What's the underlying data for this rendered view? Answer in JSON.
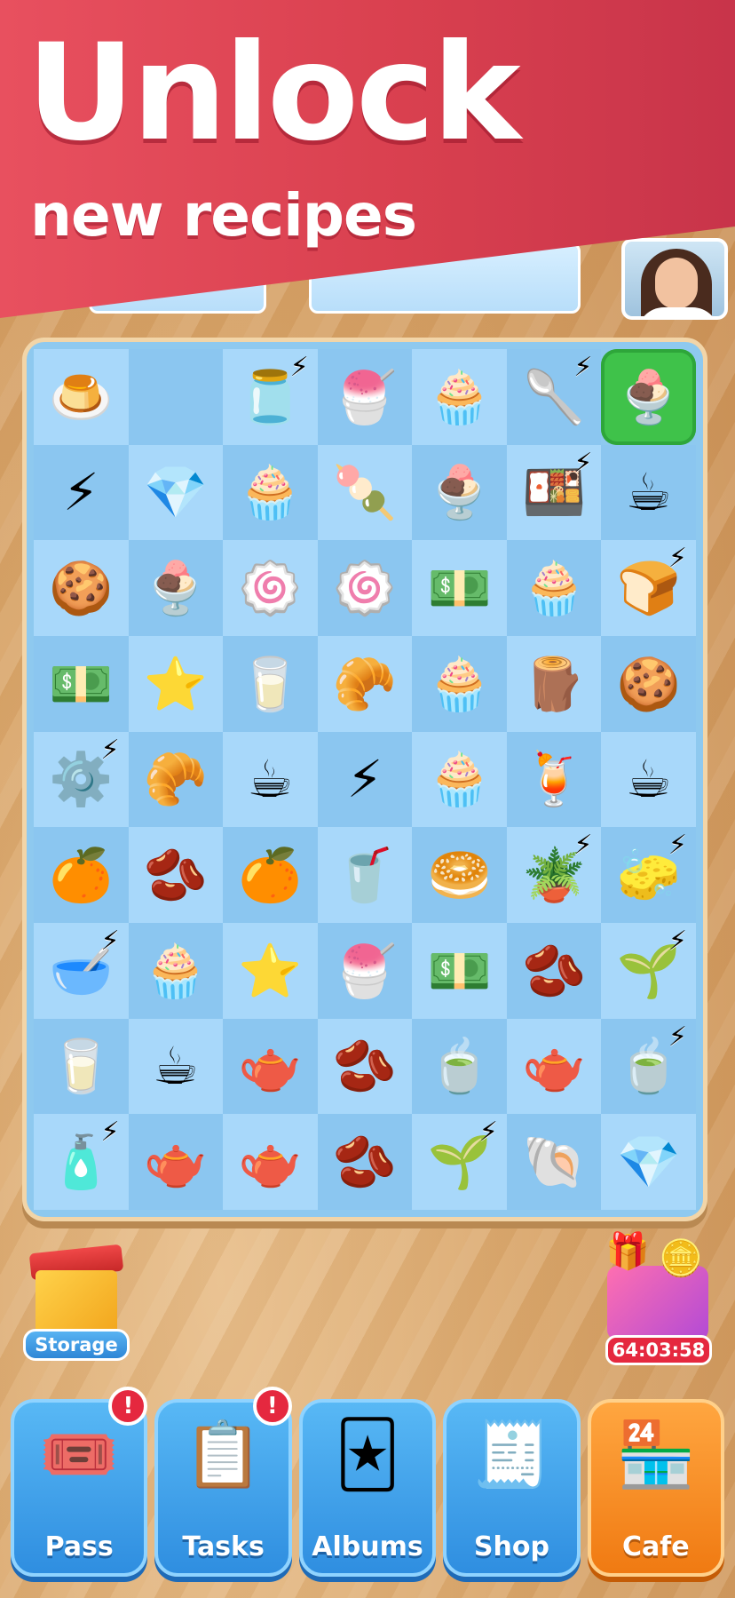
{
  "banner": {
    "title": "Unlock",
    "subtitle": "new recipes"
  },
  "board": {
    "columns": 7,
    "rows": 9,
    "cells": [
      {
        "icon": "🍮",
        "name": "pudding-item"
      },
      {
        "icon": "",
        "name": "empty-cell"
      },
      {
        "icon": "🫙",
        "name": "tea-tin-generator",
        "bolt": true
      },
      {
        "icon": "🍧",
        "name": "strawberry-dessert-item"
      },
      {
        "icon": "🧁",
        "name": "cupcake-item"
      },
      {
        "icon": "🥄",
        "name": "tongs-generator",
        "bolt": true
      },
      {
        "icon": "🍨",
        "name": "berry-dessert-item",
        "selected": true
      },
      {
        "icon": "⚡",
        "name": "energy-item"
      },
      {
        "icon": "💎",
        "name": "gem-item"
      },
      {
        "icon": "🧁",
        "name": "sprinkle-cupcake-item"
      },
      {
        "icon": "🍡",
        "name": "candy-skewer-item"
      },
      {
        "icon": "🍨",
        "name": "parfait-item"
      },
      {
        "icon": "🍱",
        "name": "lunchbox-generator",
        "bolt": true
      },
      {
        "icon": "☕",
        "name": "coffee-cup-item"
      },
      {
        "icon": "🍪",
        "name": "cookies-item"
      },
      {
        "icon": "🍨",
        "name": "berry-dessert-item"
      },
      {
        "icon": "🍥",
        "name": "roll-cakes-item"
      },
      {
        "icon": "🍥",
        "name": "roll-cakes-item"
      },
      {
        "icon": "💵",
        "name": "cash-stack-item"
      },
      {
        "icon": "🧁",
        "name": "muffin-item"
      },
      {
        "icon": "🍞",
        "name": "toaster-generator",
        "bolt": true
      },
      {
        "icon": "💵",
        "name": "cash-item"
      },
      {
        "icon": "⭐",
        "name": "star-item"
      },
      {
        "icon": "🥛",
        "name": "water-glass-item"
      },
      {
        "icon": "🥐",
        "name": "braided-bread-item"
      },
      {
        "icon": "🧁",
        "name": "muffin-item"
      },
      {
        "icon": "🪵",
        "name": "cinnamon-item"
      },
      {
        "icon": "🍪",
        "name": "macaron-item"
      },
      {
        "icon": "⚙️",
        "name": "coffee-grinder-generator",
        "bolt": true
      },
      {
        "icon": "🥐",
        "name": "croissant-item"
      },
      {
        "icon": "☕",
        "name": "latte-item"
      },
      {
        "icon": "⚡",
        "name": "energy-item"
      },
      {
        "icon": "🧁",
        "name": "lemon-cupcake-item"
      },
      {
        "icon": "🍹",
        "name": "cocktail-item"
      },
      {
        "icon": "☕",
        "name": "coffee-cup-item"
      },
      {
        "icon": "🍊",
        "name": "orange-slices-item"
      },
      {
        "icon": "🫘",
        "name": "cocoa-pod-item"
      },
      {
        "icon": "🍊",
        "name": "orange-slices-item"
      },
      {
        "icon": "🥤",
        "name": "iced-latte-item"
      },
      {
        "icon": "🥯",
        "name": "blueberry-bun-item"
      },
      {
        "icon": "🪴",
        "name": "plant-pot-generator",
        "bolt": true
      },
      {
        "icon": "🧽",
        "name": "sponge-generator",
        "bolt": true
      },
      {
        "icon": "🥣",
        "name": "whisk-generator",
        "bolt": true
      },
      {
        "icon": "🧁",
        "name": "muffin-item"
      },
      {
        "icon": "⭐",
        "name": "star-item"
      },
      {
        "icon": "🍧",
        "name": "strawberry-dessert-item"
      },
      {
        "icon": "💵",
        "name": "cash-item"
      },
      {
        "icon": "🫘",
        "name": "coffee-beans-item"
      },
      {
        "icon": "🌱",
        "name": "sprout-generator",
        "bolt": true
      },
      {
        "icon": "🥛",
        "name": "glass-item"
      },
      {
        "icon": "☕",
        "name": "cappuccino-item"
      },
      {
        "icon": "🫖",
        "name": "water-pitcher-item"
      },
      {
        "icon": "🫘",
        "name": "coffee-beans-item"
      },
      {
        "icon": "🍵",
        "name": "lemon-tea-item"
      },
      {
        "icon": "🫖",
        "name": "teapot-item"
      },
      {
        "icon": "🍵",
        "name": "matcha-generator",
        "bolt": true
      },
      {
        "icon": "🧴",
        "name": "water-bottle-generator",
        "bolt": true
      },
      {
        "icon": "🫖",
        "name": "pitcher-item"
      },
      {
        "icon": "🫖",
        "name": "pitcher-item"
      },
      {
        "icon": "🫘",
        "name": "cocoa-pod-item"
      },
      {
        "icon": "🌱",
        "name": "sprout-generator",
        "bolt": true
      },
      {
        "icon": "🐚",
        "name": "madeleine-item"
      },
      {
        "icon": "💎",
        "name": "gem-item"
      }
    ]
  },
  "storage": {
    "label": "Storage",
    "icon": "gift-box-icon"
  },
  "offer": {
    "timer": "64:03:58",
    "icon": "treasure-chest-icon"
  },
  "nav": {
    "items": [
      {
        "label": "Pass",
        "icon": "🎟️",
        "name": "pass",
        "badge": "!"
      },
      {
        "label": "Tasks",
        "icon": "📋",
        "name": "tasks",
        "badge": "!"
      },
      {
        "label": "Albums",
        "icon": "🃏",
        "name": "albums",
        "badge": ""
      },
      {
        "label": "Shop",
        "icon": "🧾",
        "name": "shop",
        "badge": ""
      },
      {
        "label": "Cafe",
        "icon": "🏪",
        "name": "cafe",
        "badge": "",
        "active": true
      }
    ]
  },
  "colors": {
    "banner": "#e8505f",
    "board_light": "#a8d8fa",
    "board_dark": "#8bc6f0",
    "selected": "#3fc24a",
    "nav_button": "#3a9be6",
    "nav_active": "#f58a22",
    "badge": "#e5283f"
  }
}
